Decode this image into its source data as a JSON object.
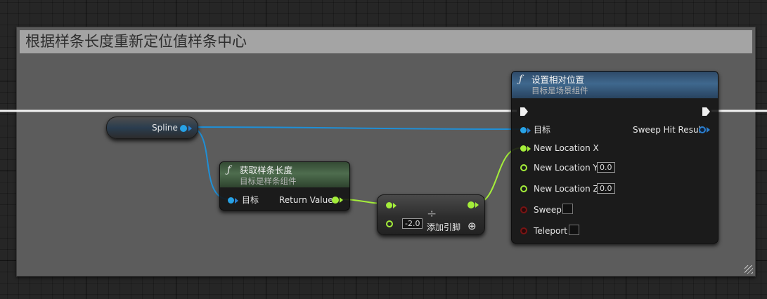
{
  "comment": {
    "title": "根据样条长度重新定位值样条中心"
  },
  "spline_node": {
    "label": "Spline"
  },
  "get_length_node": {
    "title": "获取样条长度",
    "subtitle": "目标是样条组件",
    "input_target": "目标",
    "output_return": "Return Value"
  },
  "divide_node": {
    "symbol": "÷",
    "input_b_value": "-2.0",
    "add_pin_label": "添加引脚",
    "add_pin_icon": "⊕"
  },
  "set_location_node": {
    "title": "设置相对位置",
    "subtitle": "目标是场景组件",
    "input_target": "目标",
    "output_sweep_hit": "Sweep Hit Result",
    "new_location_x": "New Location X",
    "new_location_y": "New Location Y",
    "new_location_y_value": "0.0",
    "new_location_z": "New Location Z",
    "new_location_z_value": "0.0",
    "sweep": "Sweep",
    "teleport": "Teleport"
  },
  "colors": {
    "exec_wire": "#f2f2f2",
    "object_wire": "#1f8fd6",
    "float_wire": "#a4ee3a",
    "comment_header": "#a4a4a4",
    "comment_body": "#5c5c5c"
  }
}
